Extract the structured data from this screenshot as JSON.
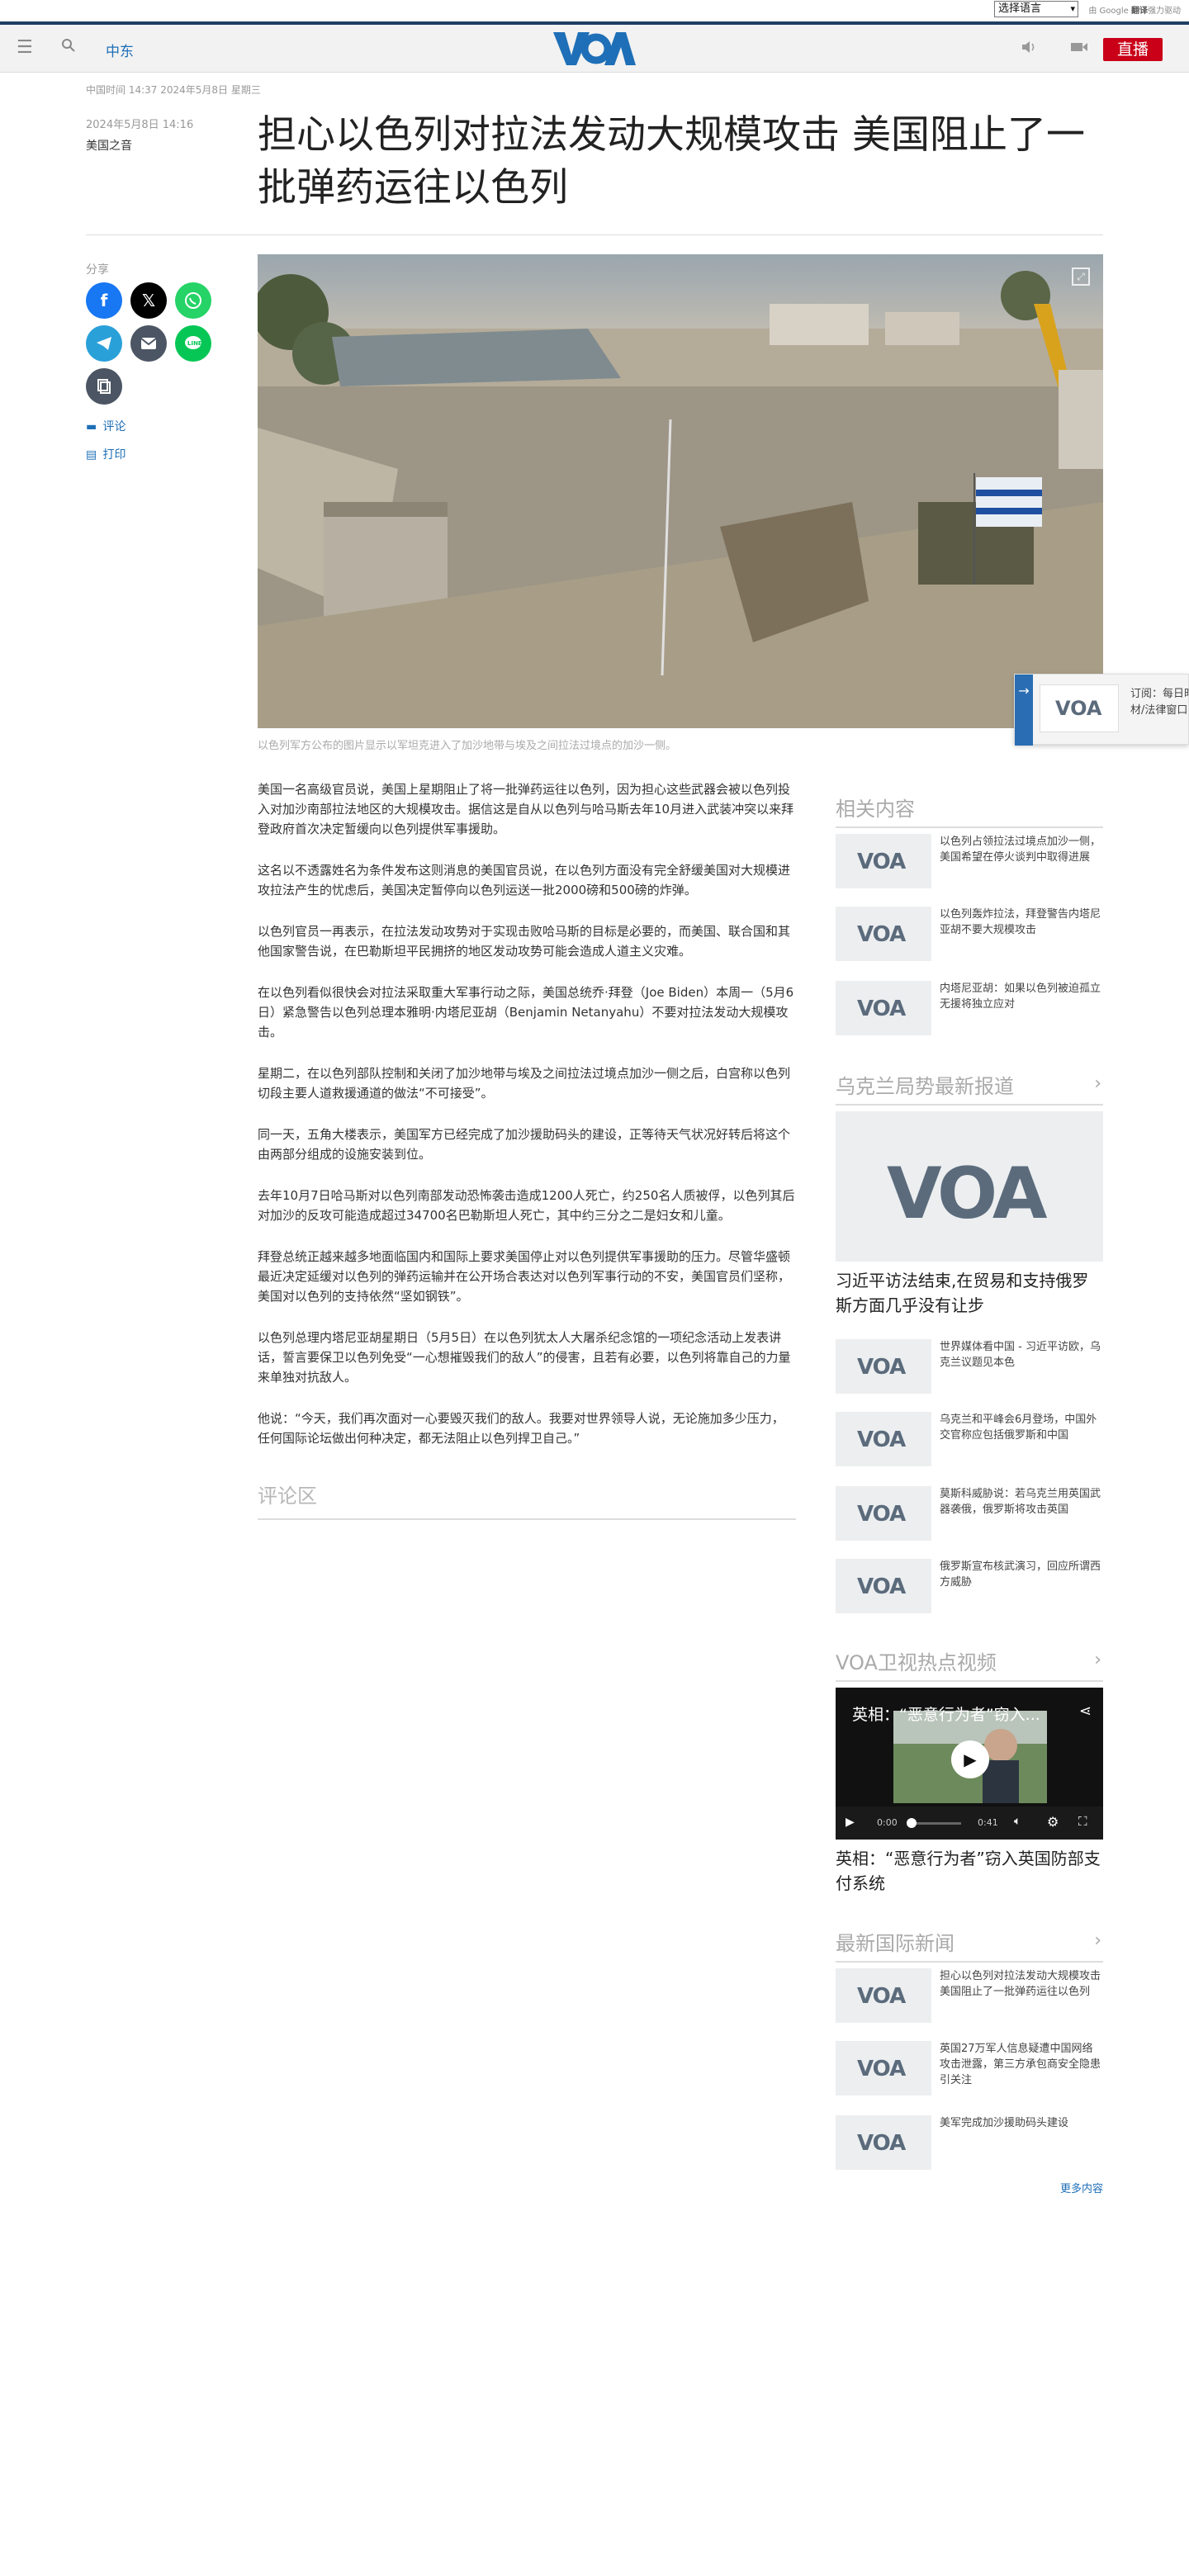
{
  "top": {
    "language_select": "选择语言",
    "google_powered": "由 Google",
    "google_translate": "翻译",
    "translate_suffix": "强力驱动"
  },
  "header": {
    "section": "中东",
    "logo_text": "VOA",
    "live_label": "直播"
  },
  "article": {
    "timeline": "中国时间 14:37 2024年5月8日 星期三",
    "pubdate": "2024年5月8日 14:16",
    "author": "美国之音",
    "headline": "担心以色列对拉法发动大规模攻击 美国阻止了一批弹药运往以色列",
    "share_label": "分享",
    "comment_label": "评论",
    "print_label": "打印",
    "caption": "以色列军方公布的图片显示以军坦克进入了加沙地带与埃及之间拉法过境点的加沙一侧。",
    "paragraphs": [
      "美国一名高级官员说，美国上星期阻止了将一批弹药运往以色列，因为担心这些武器会被以色列投入对加沙南部拉法地区的大规模攻击。据信这是自从以色列与哈马斯去年10月进入武装冲突以来拜登政府首次决定暂缓向以色列提供军事援助。",
      "这名以不透露姓名为条件发布这则消息的美国官员说，在以色列方面没有完全舒缓美国对大规模进攻拉法产生的忧虑后，美国决定暂停向以色列运送一批2000磅和500磅的炸弹。",
      "以色列官员一再表示，在拉法发动攻势对于实现击败哈马斯的目标是必要的，而美国、联合国和其他国家警告说，在巴勒斯坦平民拥挤的地区发动攻势可能会造成人道主义灾难。",
      "在以色列看似很快会对拉法采取重大军事行动之际，美国总统乔·拜登（Joe Biden）本周一（5月6日）紧急警告以色列总理本雅明·内塔尼亚胡（Benjamin Netanyahu）不要对拉法发动大规模攻击。",
      "星期二，在以色列部队控制和关闭了加沙地带与埃及之间拉法过境点加沙一侧之后，白宫称以色列切段主要人道救援通道的做法“不可接受”。",
      "同一天，五角大楼表示，美国军方已经完成了加沙援助码头的建设，正等待天气状况好转后将这个由两部分组成的设施安装到位。",
      "去年10月7日哈马斯对以色列南部发动恐怖袭击造成1200人死亡，约250名人质被俘，以色列其后对加沙的反攻可能造成超过34700名巴勒斯坦人死亡，其中约三分之二是妇女和儿童。",
      "拜登总统正越来越多地面临国内和国际上要求美国停止对以色列提供军事援助的压力。尽管华盛顿最近决定延缓对以色列的弹药运输并在公开场合表达对以色列军事行动的不安，美国官员们坚称，美国对以色列的支持依然“坚如钢铁”。",
      "以色列总理内塔尼亚胡星期日（5月5日）在以色列犹太人大屠杀纪念馆的一项纪念活动上发表讲话，誓言要保卫以色列免受“一心想摧毁我们的敌人”的侵害，且若有必要，以色列将靠自己的力量来单独对抗敌人。",
      "他说：“今天，我们再次面对一心要毁灭我们的敌人。我要对世界领导人说，无论施加多少压力，任何国际论坛做出何种决定，都无法阻止以色列捍卫自己。”"
    ],
    "comments_heading": "评论区"
  },
  "sidebar": {
    "related": {
      "heading": "相关内容",
      "items": [
        "以色列占领拉法过境点加沙一侧，美国希望在停火谈判中取得进展",
        "以色列轰炸拉法，拜登警告内塔尼亚胡不要大规模攻击",
        "内塔尼亚胡：如果以色列被迫孤立无援将独立应对"
      ]
    },
    "ukraine": {
      "heading": "乌克兰局势最新报道",
      "feature_title": "习近平访法结束,在贸易和支持俄罗斯方面几乎没有让步",
      "items": [
        "世界媒体看中国 - 习近平访欧，乌克兰议题见本色",
        "乌克兰和平峰会6月登场，中国外交官称应包括俄罗斯和中国",
        "莫斯科威胁说：若乌克兰用英国武器袭俄，俄罗斯将攻击英国",
        "俄罗斯宣布核武演习，回应所谓西方威胁"
      ]
    },
    "video": {
      "heading": "VOA卫视热点视频",
      "overlay_title": "英相：“恶意行为者”窃入...",
      "time_current": "0:00",
      "time_total": "0:41",
      "title": "英相：“恶意行为者”窃入英国防部支付系统"
    },
    "intl": {
      "heading": "最新国际新闻",
      "items": [
        "担心以色列对拉法发动大规模攻击 美国阻止了一批弹药运往以色列",
        "英国27万军人信息疑遭中国网络攻击泄露，第三方承包商安全隐患引关注",
        "美军完成加沙援助码头建设"
      ],
      "more": "更多内容"
    }
  },
  "popup": {
    "text_line1": "订阅：每日时事",
    "text_line2": "材/法律窗口"
  },
  "colors": {
    "brand_blue": "#1e6fb7",
    "live_red": "#c90018",
    "facebook": "#1877f2",
    "x": "#000000",
    "whatsapp": "#25d366",
    "telegram": "#2aa0d9",
    "email": "#4b5563",
    "line": "#06c755",
    "copy": "#4b5563"
  }
}
